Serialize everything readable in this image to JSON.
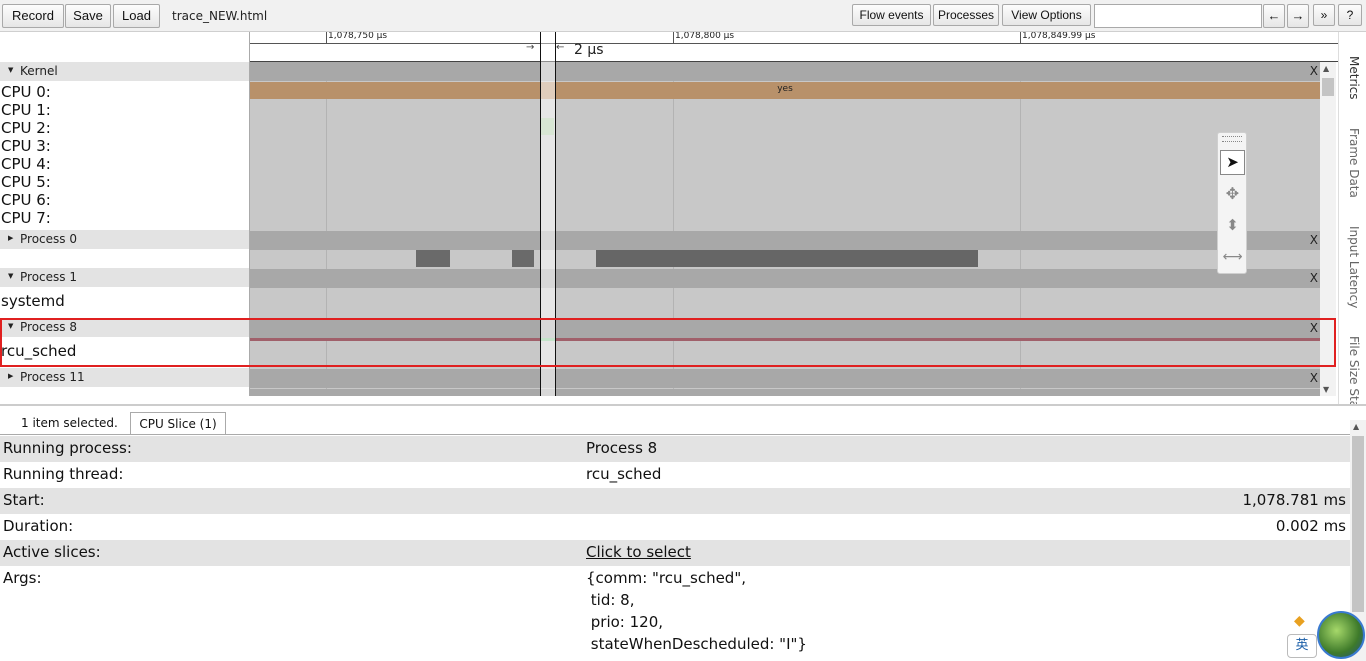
{
  "toolbar": {
    "record_label": "Record",
    "save_label": "Save",
    "load_label": "Load",
    "trace_title": "trace_NEW.html",
    "flow_events_label": "Flow events",
    "processes_label": "Processes",
    "view_options_label": "View Options",
    "search_placeholder": "",
    "prev_label": "←",
    "next_label": "→",
    "more_label": "»",
    "help_label": "?"
  },
  "ruler": {
    "ticks": [
      "1,078,750 µs",
      "1,078,800 µs",
      "1,078,849.99 µs"
    ],
    "selection_duration": "2 µs"
  },
  "tracks": {
    "kernel": {
      "label": "Kernel",
      "cpus": [
        "CPU 0:",
        "CPU 1:",
        "CPU 2:",
        "CPU 3:",
        "CPU 4:",
        "CPU 5:",
        "CPU 6:",
        "CPU 7:"
      ],
      "cpu0_slice_label": "yes"
    },
    "process0": {
      "label": "Process 0"
    },
    "process1": {
      "label": "Process 1",
      "thread": "systemd"
    },
    "process8": {
      "label": "Process 8",
      "thread": "rcu_sched"
    },
    "process11": {
      "label": "Process 11"
    },
    "close_label": "X"
  },
  "side_tabs": [
    "Metrics",
    "Frame Data",
    "Input Latency",
    "File Size Stats"
  ],
  "panel": {
    "selection_count": "1 item selected.",
    "tab_label": "CPU Slice (1)",
    "rows": {
      "running_process": {
        "key": "Running process:",
        "value": "Process 8"
      },
      "running_thread": {
        "key": "Running thread:",
        "value": "rcu_sched"
      },
      "start": {
        "key": "Start:",
        "value": "1,078.781 ms"
      },
      "duration": {
        "key": "Duration:",
        "value": "0.002 ms"
      },
      "active_slices": {
        "key": "Active slices:",
        "value": "Click to select"
      },
      "args": {
        "key": "Args:",
        "lines": [
          "{comm: \"rcu_sched\",",
          " tid: 8,",
          " prio: 120,",
          " stateWhenDescheduled: \"I\"}"
        ]
      }
    }
  },
  "taskbar": {
    "ime_label": "英"
  },
  "colors": {
    "cpu0_slice": "#b8916a",
    "highlight_box": "#e02020",
    "rcu_line": "#a0606a",
    "selected_slice": "#7cc48a"
  }
}
